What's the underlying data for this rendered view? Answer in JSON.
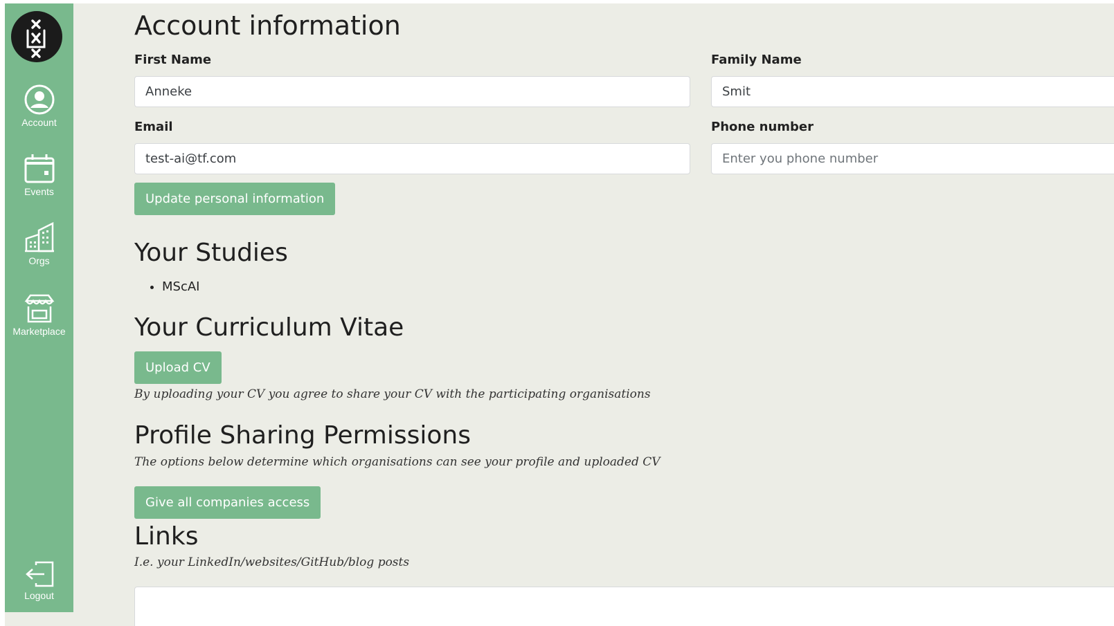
{
  "sidebar": {
    "logo_icon": "university-crest-icon",
    "items": [
      {
        "label": "Account",
        "icon": "user-circle-icon"
      },
      {
        "label": "Events",
        "icon": "calendar-icon"
      },
      {
        "label": "Orgs",
        "icon": "buildings-icon"
      },
      {
        "label": "Marketplace",
        "icon": "storefront-icon"
      }
    ],
    "logout": {
      "label": "Logout",
      "icon": "logout-icon"
    },
    "color": "#79b98d"
  },
  "account": {
    "title": "Account information",
    "first_name_label": "First Name",
    "first_name_value": "Anneke",
    "family_name_label": "Family Name",
    "family_name_value": "Smit",
    "email_label": "Email",
    "email_value": "test-ai@tf.com",
    "phone_label": "Phone number",
    "phone_placeholder": "Enter you phone number",
    "update_button": "Update personal information"
  },
  "studies": {
    "title": "Your Studies",
    "items": [
      "MScAI"
    ]
  },
  "cv": {
    "title": "Your Curriculum Vitae",
    "upload_button": "Upload CV",
    "note": "By uploading your CV you agree to share your CV with the participating organisations"
  },
  "permissions": {
    "title": "Profile Sharing Permissions",
    "note": "The options below determine which organisations can see your profile and uploaded CV",
    "give_access_button": "Give all companies access"
  },
  "links": {
    "title": "Links",
    "note": "I.e. your LinkedIn/websites/GitHub/blog posts",
    "value": ""
  },
  "colors": {
    "accent": "#79b98d",
    "background": "#ecede6"
  }
}
